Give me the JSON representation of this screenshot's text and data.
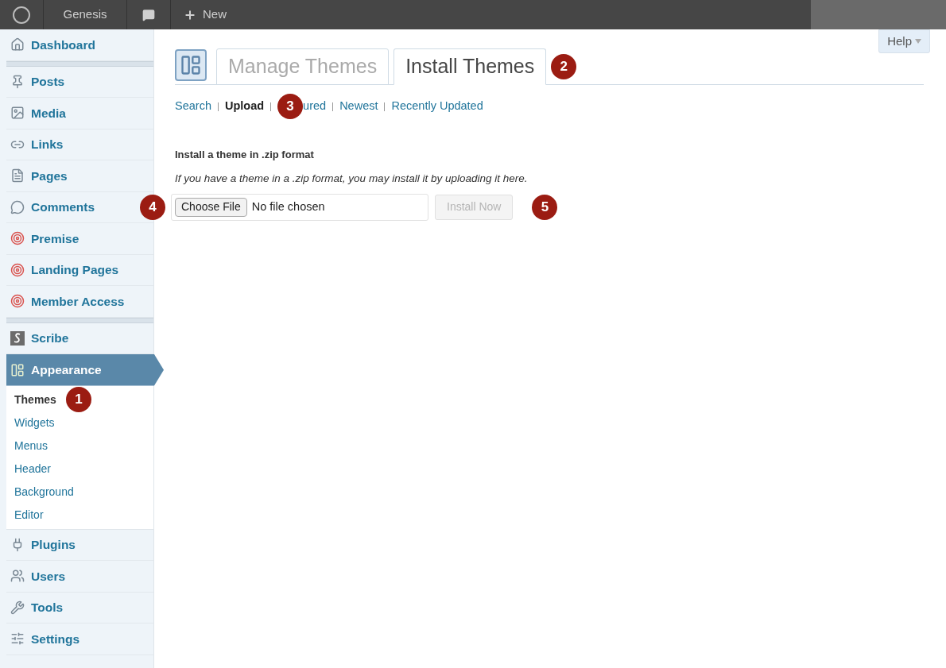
{
  "admin_bar": {
    "site_name": "Genesis",
    "new_label": "New"
  },
  "help_button": {
    "label": "Help"
  },
  "sidebar": {
    "groups": [
      [
        {
          "label": "Dashboard",
          "selected": false
        }
      ],
      [
        {
          "label": "Posts",
          "selected": false
        },
        {
          "label": "Media",
          "selected": false
        },
        {
          "label": "Links",
          "selected": false
        },
        {
          "label": "Pages",
          "selected": false
        },
        {
          "label": "Comments",
          "selected": false
        },
        {
          "label": "Premise",
          "selected": false
        },
        {
          "label": "Landing Pages",
          "selected": false
        },
        {
          "label": "Member Access",
          "selected": false
        }
      ],
      [
        {
          "label": "Scribe",
          "selected": false
        },
        {
          "label": "Appearance",
          "selected": true,
          "children": [
            {
              "label": "Themes",
              "selected": true,
              "callout": "1"
            },
            {
              "label": "Widgets",
              "selected": false
            },
            {
              "label": "Menus",
              "selected": false
            },
            {
              "label": "Header",
              "selected": false
            },
            {
              "label": "Background",
              "selected": false
            },
            {
              "label": "Editor",
              "selected": false
            }
          ]
        },
        {
          "label": "Plugins",
          "selected": false
        },
        {
          "label": "Users",
          "selected": false
        },
        {
          "label": "Tools",
          "selected": false
        },
        {
          "label": "Settings",
          "selected": false
        }
      ]
    ]
  },
  "tabs": [
    {
      "label": "Manage Themes",
      "selected": false
    },
    {
      "label": "Install Themes",
      "selected": true,
      "callout": "2"
    }
  ],
  "subnav": [
    {
      "label": "Search",
      "selected": false
    },
    {
      "label": "Upload",
      "selected": true
    },
    {
      "label": "ured",
      "selected": false,
      "callout": "3"
    },
    {
      "label": "Newest",
      "selected": false
    },
    {
      "label": "Recently Updated",
      "selected": false
    }
  ],
  "upload": {
    "heading": "Install a theme in .zip format",
    "description": "If you have a theme in a .zip format, you may install it by uploading it here.",
    "choose_button": "Choose File",
    "file_status": "No file chosen",
    "choose_callout": "4",
    "install_button": {
      "label": "Install Now",
      "disabled": true
    },
    "install_callout": "5"
  }
}
